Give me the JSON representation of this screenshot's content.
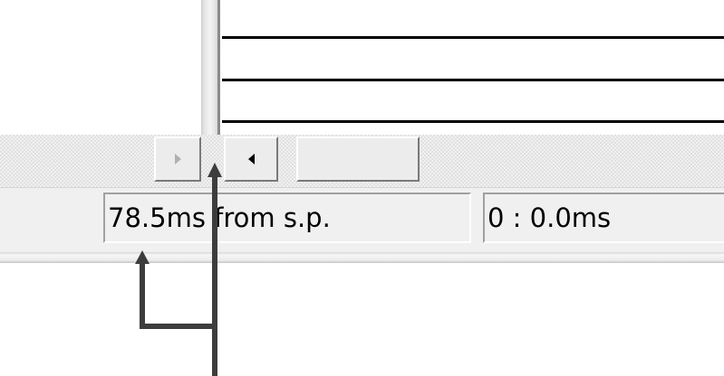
{
  "status_bar": {
    "time_from_start": "78.5ms from s.p.",
    "position": "0 : 0.0ms"
  },
  "scrollbar": {
    "right_arrow_icon": "triangle-right",
    "left_arrow_icon": "triangle-left"
  },
  "colors": {
    "annotation_arrow": "#3d3d3d",
    "window_background": "#f0f0f0",
    "waveform": "#000000"
  }
}
